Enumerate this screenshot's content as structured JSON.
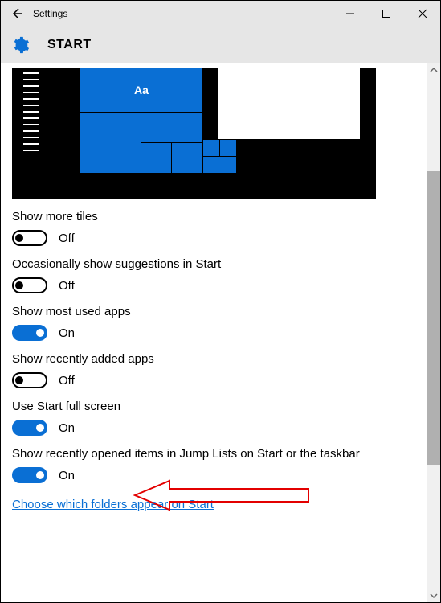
{
  "titlebar": {
    "title": "Settings"
  },
  "header": {
    "title": "START"
  },
  "preview": {
    "tile_label": "Aa"
  },
  "settings": [
    {
      "label": "Show more tiles",
      "state_text": "Off",
      "state": "off"
    },
    {
      "label": "Occasionally show suggestions in Start",
      "state_text": "Off",
      "state": "off"
    },
    {
      "label": "Show most used apps",
      "state_text": "On",
      "state": "on"
    },
    {
      "label": "Show recently added apps",
      "state_text": "Off",
      "state": "off"
    },
    {
      "label": "Use Start full screen",
      "state_text": "On",
      "state": "on"
    },
    {
      "label": "Show recently opened items in Jump Lists on Start or the taskbar",
      "state_text": "On",
      "state": "on"
    }
  ],
  "link": {
    "choose_folders": "Choose which folders appear on Start"
  }
}
